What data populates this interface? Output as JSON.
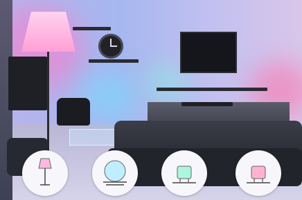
{
  "scene": {
    "colors": {
      "floor_lamp": "#ff9fd6",
      "orb_light": "#7fdcff",
      "teal_light": "#7ff0d0",
      "pink_light": "#ff8fc0"
    },
    "lights": [
      {
        "icon": "floor-lamp-icon"
      },
      {
        "icon": "orb-lamp-icon"
      },
      {
        "icon": "table-lamp-teal-icon"
      },
      {
        "icon": "table-lamp-pink-icon"
      }
    ]
  }
}
